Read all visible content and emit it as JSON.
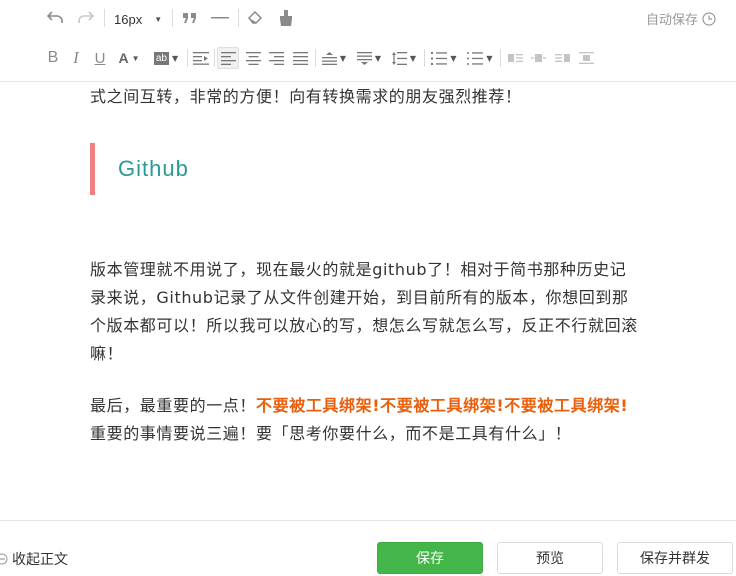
{
  "toolbar": {
    "font_size": "16px",
    "autosave_label": "自动保存",
    "bold": "B",
    "italic": "I",
    "underline": "U",
    "font_color": "A",
    "background_color": "ab"
  },
  "content": {
    "intro_tail": "式之间互转，非常的方便！向有转换需求的朋友强烈推荐！",
    "heading": "Github",
    "para1": "版本管理就不用说了，现在最火的就是github了！相对于简书那种历史记录来说，Github记录了从文件创建开始，到目前所有的版本，你想回到那个版本都可以！所以我可以放心的写，想怎么写就怎么写，反正不行就回滚嘛！",
    "para2_start": "最后，最重要的一点！",
    "para2_emphasis": "不要被工具绑架!不要被工具绑架!不要被工具绑架!",
    "para2_end": "重要的事情要说三遍！要「思考你要什么，而不是工具有什么」！"
  },
  "footer": {
    "collapse_label": "收起正文",
    "save_label": "保存",
    "preview_label": "预览",
    "publish_label": "保存并群发"
  },
  "colors": {
    "accent_green": "#44b549",
    "heading_teal": "#2b9a93",
    "heading_bar": "#f08080",
    "emphasis_orange": "#e8600d"
  }
}
